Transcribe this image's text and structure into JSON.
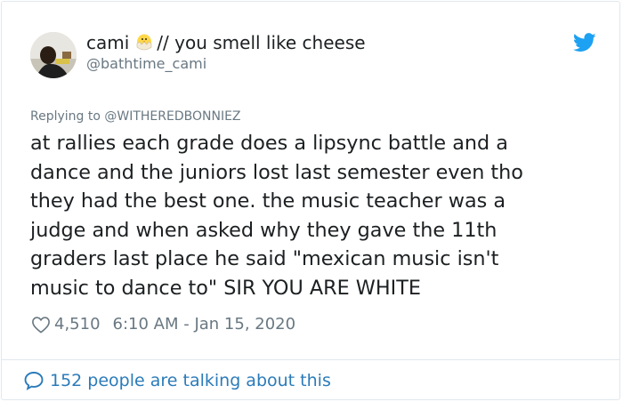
{
  "author": {
    "name_prefix": "cami",
    "name_suffix": "// you smell like cheese",
    "handle": "@bathtime_cami"
  },
  "reply": {
    "text": "Replying to @WITHEREDBONNIEZ"
  },
  "tweet": {
    "text": "at rallies each grade does a lipsync battle and a\ndance and the juniors lost last semester even tho\nthey had the best one. the music teacher was a\njudge and when asked why they gave the 11th\ngraders last place he said \"mexican music isn't\nmusic to dance to\" SIR YOU ARE WHITE"
  },
  "meta": {
    "likes": "4,510",
    "timestamp": "6:10 AM - Jan 15, 2020"
  },
  "footer": {
    "talking": "152 people are talking about this"
  },
  "icons": {
    "bird": "twitter-bird-icon",
    "heart": "heart-icon",
    "bubble": "speech-bubble-icon",
    "chick": "hatching-chick-emoji"
  },
  "colors": {
    "twitter_blue": "#1da1f2",
    "link_blue": "#2b7bb9",
    "muted": "#697882",
    "text": "#1c2022"
  }
}
